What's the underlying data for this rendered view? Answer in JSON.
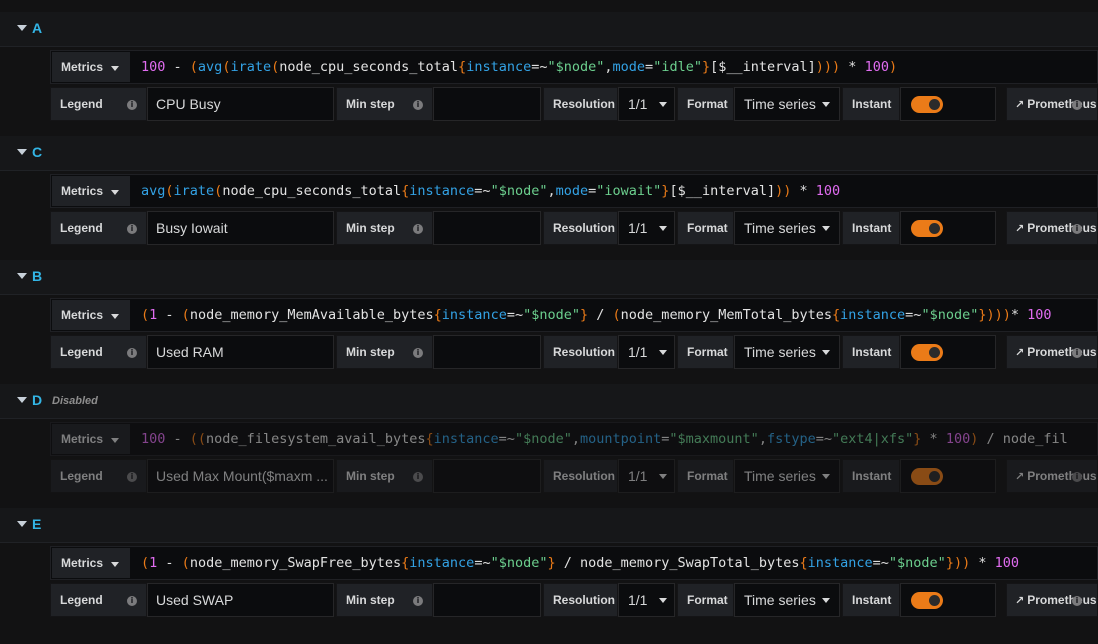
{
  "queries": [
    {
      "letter": "A",
      "disabled_label": "",
      "metrics_label": "Metrics",
      "expr": [
        {
          "t": "100",
          "c": "n"
        },
        {
          "t": " - ",
          "c": "op"
        },
        {
          "t": "(",
          "c": "br"
        },
        {
          "t": "avg",
          "c": "fn"
        },
        {
          "t": "(",
          "c": "br"
        },
        {
          "t": "irate",
          "c": "fn"
        },
        {
          "t": "(",
          "c": "br"
        },
        {
          "t": "node_cpu_seconds_total",
          "c": "id"
        },
        {
          "t": "{",
          "c": "br"
        },
        {
          "t": "instance",
          "c": "lbl"
        },
        {
          "t": "=~",
          "c": "op"
        },
        {
          "t": "\"$node\"",
          "c": "str"
        },
        {
          "t": ",",
          "c": "op"
        },
        {
          "t": "mode",
          "c": "lbl"
        },
        {
          "t": "=",
          "c": "op"
        },
        {
          "t": "\"idle\"",
          "c": "str"
        },
        {
          "t": "}",
          "c": "br"
        },
        {
          "t": "[$__interval]",
          "c": "id"
        },
        {
          "t": ")))",
          "c": "br"
        },
        {
          "t": " * ",
          "c": "op"
        },
        {
          "t": "100",
          "c": "n"
        },
        {
          "t": ")",
          "c": "br"
        }
      ],
      "legend_label": "Legend",
      "legend_value": "CPU Busy",
      "min_step_label": "Min step",
      "min_step_value": "",
      "resolution_label": "Resolution",
      "resolution_value": "1/1",
      "format_label": "Format",
      "format_value": "Time series",
      "instant_label": "Instant",
      "instant_on": true,
      "datasource": "Prometheus"
    },
    {
      "letter": "C",
      "disabled_label": "",
      "metrics_label": "Metrics",
      "expr": [
        {
          "t": "avg",
          "c": "fn"
        },
        {
          "t": "(",
          "c": "br"
        },
        {
          "t": "irate",
          "c": "fn"
        },
        {
          "t": "(",
          "c": "br"
        },
        {
          "t": "node_cpu_seconds_total",
          "c": "id"
        },
        {
          "t": "{",
          "c": "br"
        },
        {
          "t": "instance",
          "c": "lbl"
        },
        {
          "t": "=~",
          "c": "op"
        },
        {
          "t": "\"$node\"",
          "c": "str"
        },
        {
          "t": ",",
          "c": "op"
        },
        {
          "t": "mode",
          "c": "lbl"
        },
        {
          "t": "=",
          "c": "op"
        },
        {
          "t": "\"iowait\"",
          "c": "str"
        },
        {
          "t": "}",
          "c": "br"
        },
        {
          "t": "[$__interval]",
          "c": "id"
        },
        {
          "t": "))",
          "c": "br"
        },
        {
          "t": " * ",
          "c": "op"
        },
        {
          "t": "100",
          "c": "n"
        }
      ],
      "legend_label": "Legend",
      "legend_value": "Busy Iowait",
      "min_step_label": "Min step",
      "min_step_value": "",
      "resolution_label": "Resolution",
      "resolution_value": "1/1",
      "format_label": "Format",
      "format_value": "Time series",
      "instant_label": "Instant",
      "instant_on": true,
      "datasource": "Prometheus"
    },
    {
      "letter": "B",
      "disabled_label": "",
      "metrics_label": "Metrics",
      "expr": [
        {
          "t": "(",
          "c": "br"
        },
        {
          "t": "1",
          "c": "n"
        },
        {
          "t": " - ",
          "c": "op"
        },
        {
          "t": "(",
          "c": "br"
        },
        {
          "t": "node_memory_MemAvailable_bytes",
          "c": "id"
        },
        {
          "t": "{",
          "c": "br"
        },
        {
          "t": "instance",
          "c": "lbl"
        },
        {
          "t": "=~",
          "c": "op"
        },
        {
          "t": "\"$node\"",
          "c": "str"
        },
        {
          "t": "}",
          "c": "br"
        },
        {
          "t": " / ",
          "c": "op"
        },
        {
          "t": "(",
          "c": "br"
        },
        {
          "t": "node_memory_MemTotal_bytes",
          "c": "id"
        },
        {
          "t": "{",
          "c": "br"
        },
        {
          "t": "instance",
          "c": "lbl"
        },
        {
          "t": "=~",
          "c": "op"
        },
        {
          "t": "\"$node\"",
          "c": "str"
        },
        {
          "t": "})))",
          "c": "br"
        },
        {
          "t": "* ",
          "c": "op"
        },
        {
          "t": "100",
          "c": "n"
        }
      ],
      "legend_label": "Legend",
      "legend_value": "Used RAM",
      "min_step_label": "Min step",
      "min_step_value": "",
      "resolution_label": "Resolution",
      "resolution_value": "1/1",
      "format_label": "Format",
      "format_value": "Time series",
      "instant_label": "Instant",
      "instant_on": true,
      "datasource": "Prometheus"
    },
    {
      "letter": "D",
      "disabled_label": "Disabled",
      "metrics_label": "Metrics",
      "expr": [
        {
          "t": "100",
          "c": "n"
        },
        {
          "t": " - ",
          "c": "op"
        },
        {
          "t": "((",
          "c": "br"
        },
        {
          "t": "node_filesystem_avail_bytes",
          "c": "id"
        },
        {
          "t": "{",
          "c": "br"
        },
        {
          "t": "instance",
          "c": "lbl"
        },
        {
          "t": "=~",
          "c": "op"
        },
        {
          "t": "\"$node\"",
          "c": "str"
        },
        {
          "t": ",",
          "c": "op"
        },
        {
          "t": "mountpoint",
          "c": "lbl"
        },
        {
          "t": "=",
          "c": "op"
        },
        {
          "t": "\"$maxmount\"",
          "c": "str"
        },
        {
          "t": ",",
          "c": "op"
        },
        {
          "t": "fstype",
          "c": "lbl"
        },
        {
          "t": "=~",
          "c": "op"
        },
        {
          "t": "\"ext4|xfs\"",
          "c": "str"
        },
        {
          "t": "}",
          "c": "br"
        },
        {
          "t": " * ",
          "c": "op"
        },
        {
          "t": "100",
          "c": "n"
        },
        {
          "t": ")",
          "c": "br"
        },
        {
          "t": " / ",
          "c": "op"
        },
        {
          "t": "node_fil",
          "c": "id"
        }
      ],
      "legend_label": "Legend",
      "legend_value": "Used Max Mount($maxm ...",
      "min_step_label": "Min step",
      "min_step_value": "",
      "resolution_label": "Resolution",
      "resolution_value": "1/1",
      "format_label": "Format",
      "format_value": "Time series",
      "instant_label": "Instant",
      "instant_on": true,
      "datasource": "Prometheus"
    },
    {
      "letter": "E",
      "disabled_label": "",
      "metrics_label": "Metrics",
      "expr": [
        {
          "t": "(",
          "c": "br"
        },
        {
          "t": "1",
          "c": "n"
        },
        {
          "t": " - ",
          "c": "op"
        },
        {
          "t": "(",
          "c": "br"
        },
        {
          "t": "node_memory_SwapFree_bytes",
          "c": "id"
        },
        {
          "t": "{",
          "c": "br"
        },
        {
          "t": "instance",
          "c": "lbl"
        },
        {
          "t": "=~",
          "c": "op"
        },
        {
          "t": "\"$node\"",
          "c": "str"
        },
        {
          "t": "}",
          "c": "br"
        },
        {
          "t": " / ",
          "c": "op"
        },
        {
          "t": "node_memory_SwapTotal_bytes",
          "c": "id"
        },
        {
          "t": "{",
          "c": "br"
        },
        {
          "t": "instance",
          "c": "lbl"
        },
        {
          "t": "=~",
          "c": "op"
        },
        {
          "t": "\"$node\"",
          "c": "str"
        },
        {
          "t": "}))",
          "c": "br"
        },
        {
          "t": " * ",
          "c": "op"
        },
        {
          "t": "100",
          "c": "n"
        }
      ],
      "legend_label": "Legend",
      "legend_value": "Used SWAP",
      "min_step_label": "Min step",
      "min_step_value": "",
      "resolution_label": "Resolution",
      "resolution_value": "1/1",
      "format_label": "Format",
      "format_value": "Time series",
      "instant_label": "Instant",
      "instant_on": true,
      "datasource": "Prometheus"
    }
  ],
  "colors": {
    "background": "#121213",
    "query_letter": "#33b5e5",
    "number": "#e06cf0",
    "function": "#33a2e5",
    "string": "#6ccf8e",
    "bracket": "#eb7b18",
    "toggle_on": "#eb7b18"
  },
  "icons": {
    "info": "info-circle-icon",
    "datasource": "external-link-icon",
    "collapse": "caret-down-icon"
  }
}
